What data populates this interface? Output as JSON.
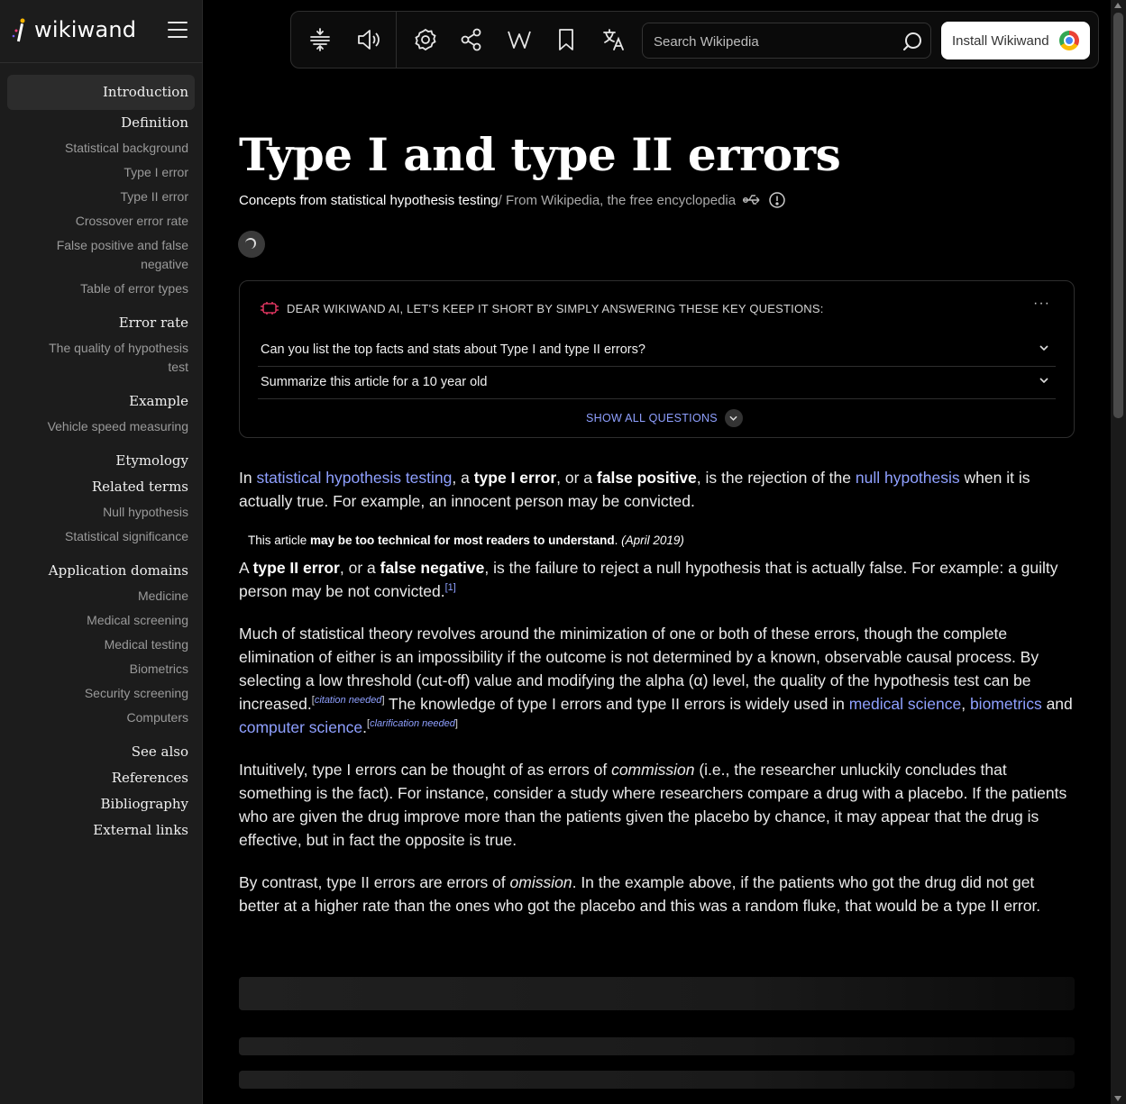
{
  "app": {
    "name": "wikiwand"
  },
  "toc": [
    {
      "label": "Introduction",
      "type": "h",
      "active": true
    },
    {
      "label": "Definition",
      "type": "h"
    },
    {
      "label": "Statistical background",
      "type": "s"
    },
    {
      "label": "Type I error",
      "type": "s"
    },
    {
      "label": "Type II error",
      "type": "s"
    },
    {
      "label": "Crossover error rate",
      "type": "s"
    },
    {
      "label": "False positive and false negative",
      "type": "s"
    },
    {
      "label": "Table of error types",
      "type": "s"
    },
    {
      "label": "Error rate",
      "type": "h"
    },
    {
      "label": "The quality of hypothesis test",
      "type": "s"
    },
    {
      "label": "Example",
      "type": "h"
    },
    {
      "label": "Vehicle speed measuring",
      "type": "s"
    },
    {
      "label": "Etymology",
      "type": "h"
    },
    {
      "label": "Related terms",
      "type": "h"
    },
    {
      "label": "Null hypothesis",
      "type": "s"
    },
    {
      "label": "Statistical significance",
      "type": "s"
    },
    {
      "label": "Application domains",
      "type": "h"
    },
    {
      "label": "Medicine",
      "type": "s"
    },
    {
      "label": "Medical screening",
      "type": "s"
    },
    {
      "label": "Medical testing",
      "type": "s"
    },
    {
      "label": "Biometrics",
      "type": "s"
    },
    {
      "label": "Security screening",
      "type": "s"
    },
    {
      "label": "Computers",
      "type": "s"
    },
    {
      "label": "See also",
      "type": "h"
    },
    {
      "label": "References",
      "type": "h"
    },
    {
      "label": "Bibliography",
      "type": "h"
    },
    {
      "label": "External links",
      "type": "h"
    }
  ],
  "toolbar": {
    "search_placeholder": "Search Wikipedia",
    "install_label": "Install Wikiwand"
  },
  "article": {
    "title": "Type I and type II errors",
    "subtitle": "Concepts from statistical hypothesis testing",
    "source": " / From Wikipedia, the free encyclopedia"
  },
  "ai": {
    "heading": "DEAR WIKIWAND AI, LET'S KEEP IT SHORT BY SIMPLY ANSWERING THESE KEY QUESTIONS:",
    "questions": [
      "Can you list the top facts and stats about Type I and type II errors?",
      "Summarize this article for a 10 year old"
    ],
    "show_all": "SHOW ALL QUESTIONS"
  },
  "content": {
    "p1": {
      "t1": "In ",
      "link1": "statistical hypothesis testing",
      "t2": ", a ",
      "b1": "type I error",
      "t3": ", or a ",
      "b2": "false positive",
      "t4": ", is the rejection of the ",
      "link2": "null hypothesis",
      "t5": " when it is actually true. For example, an innocent person may be convicted."
    },
    "note": {
      "t1": "This article ",
      "b1": "may be too technical for most readers to understand",
      "t2": ". ",
      "i1": "(April 2019)"
    },
    "p2": {
      "t1": "A ",
      "b1": "type II error",
      "t2": ", or a ",
      "b2": "false negative",
      "t3": ", is the failure to reject a null hypothesis that is actually false. For example: a guilty person may be not convicted.",
      "ref": "[1]"
    },
    "p3": {
      "t1": "Much of statistical theory revolves around the minimization of one or both of these errors, though the complete elimination of either is an impossibility if the outcome is not determined by a known, observable causal process. By selecting a low threshold (cut-off) value and modifying the alpha (α) level, the quality of the hypothesis test can be increased.",
      "cn": "citation needed",
      "t2": " The knowledge of type I errors and type II errors is widely used in ",
      "link1": "medical science",
      "t3": ", ",
      "link2": "biometrics",
      "t4": " and ",
      "link3": "computer science",
      "t5": ".",
      "clar": "clarification needed"
    },
    "p4": {
      "t1": "Intuitively, type I errors can be thought of as errors of ",
      "i1": "commission",
      "t2": " (i.e., the researcher unluckily concludes that something is the fact). For instance, consider a study where researchers compare a drug with a placebo. If the patients who are given the drug improve more than the patients given the placebo by chance, it may appear that the drug is effective, but in fact the opposite is true."
    },
    "p5": {
      "t1": "By contrast, type II errors are errors of ",
      "i1": "omission",
      "t2": ". In the example above, if the patients who got the drug did not get better at a higher rate than the ones who got the placebo and this was a random fluke, that would be a type II error."
    }
  }
}
